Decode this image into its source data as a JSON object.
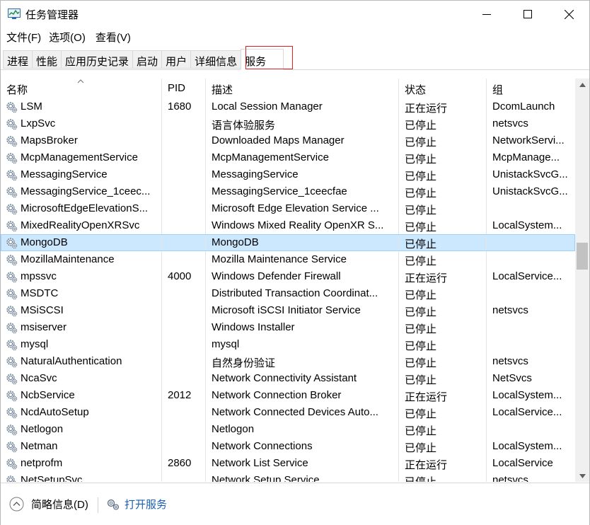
{
  "window": {
    "title": "任务管理器"
  },
  "menu": [
    {
      "label": "文件(F)"
    },
    {
      "label": "选项(O)"
    },
    {
      "label": "查看(V)"
    }
  ],
  "tabs": [
    {
      "label": "进程"
    },
    {
      "label": "性能"
    },
    {
      "label": "应用历史记录"
    },
    {
      "label": "启动"
    },
    {
      "label": "用户"
    },
    {
      "label": "详细信息"
    },
    {
      "label": "服务",
      "active": true
    }
  ],
  "columns": {
    "name": "名称",
    "pid": "PID",
    "desc": "描述",
    "status": "状态",
    "group": "组"
  },
  "rows": [
    {
      "name": "LSM",
      "pid": "1680",
      "desc": "Local Session Manager",
      "status": "正在运行",
      "group": "DcomLaunch"
    },
    {
      "name": "LxpSvc",
      "pid": "",
      "desc": "语言体验服务",
      "status": "已停止",
      "group": "netsvcs"
    },
    {
      "name": "MapsBroker",
      "pid": "",
      "desc": "Downloaded Maps Manager",
      "status": "已停止",
      "group": "NetworkServi..."
    },
    {
      "name": "McpManagementService",
      "pid": "",
      "desc": "McpManagementService",
      "status": "已停止",
      "group": "McpManage..."
    },
    {
      "name": "MessagingService",
      "pid": "",
      "desc": "MessagingService",
      "status": "已停止",
      "group": "UnistackSvcG..."
    },
    {
      "name": "MessagingService_1ceec...",
      "pid": "",
      "desc": "MessagingService_1ceecfae",
      "status": "已停止",
      "group": "UnistackSvcG..."
    },
    {
      "name": "MicrosoftEdgeElevationS...",
      "pid": "",
      "desc": "Microsoft Edge Elevation Service ...",
      "status": "已停止",
      "group": ""
    },
    {
      "name": "MixedRealityOpenXRSvc",
      "pid": "",
      "desc": "Windows Mixed Reality OpenXR S...",
      "status": "已停止",
      "group": "LocalSystem..."
    },
    {
      "name": "MongoDB",
      "pid": "",
      "desc": "MongoDB",
      "status": "已停止",
      "group": "",
      "selected": true
    },
    {
      "name": "MozillaMaintenance",
      "pid": "",
      "desc": "Mozilla Maintenance Service",
      "status": "已停止",
      "group": ""
    },
    {
      "name": "mpssvc",
      "pid": "4000",
      "desc": "Windows Defender Firewall",
      "status": "正在运行",
      "group": "LocalService..."
    },
    {
      "name": "MSDTC",
      "pid": "",
      "desc": "Distributed Transaction Coordinat...",
      "status": "已停止",
      "group": ""
    },
    {
      "name": "MSiSCSI",
      "pid": "",
      "desc": "Microsoft iSCSI Initiator Service",
      "status": "已停止",
      "group": "netsvcs"
    },
    {
      "name": "msiserver",
      "pid": "",
      "desc": "Windows Installer",
      "status": "已停止",
      "group": ""
    },
    {
      "name": "mysql",
      "pid": "",
      "desc": "mysql",
      "status": "已停止",
      "group": ""
    },
    {
      "name": "NaturalAuthentication",
      "pid": "",
      "desc": "自然身份验证",
      "status": "已停止",
      "group": "netsvcs"
    },
    {
      "name": "NcaSvc",
      "pid": "",
      "desc": "Network Connectivity Assistant",
      "status": "已停止",
      "group": "NetSvcs"
    },
    {
      "name": "NcbService",
      "pid": "2012",
      "desc": "Network Connection Broker",
      "status": "正在运行",
      "group": "LocalSystem..."
    },
    {
      "name": "NcdAutoSetup",
      "pid": "",
      "desc": "Network Connected Devices Auto...",
      "status": "已停止",
      "group": "LocalService..."
    },
    {
      "name": "Netlogon",
      "pid": "",
      "desc": "Netlogon",
      "status": "已停止",
      "group": ""
    },
    {
      "name": "Netman",
      "pid": "",
      "desc": "Network Connections",
      "status": "已停止",
      "group": "LocalSystem..."
    },
    {
      "name": "netprofm",
      "pid": "2860",
      "desc": "Network List Service",
      "status": "正在运行",
      "group": "LocalService"
    },
    {
      "name": "NetSetupSvc",
      "pid": "",
      "desc": "Network Setup Service",
      "status": "已停止",
      "group": "netsvcs"
    }
  ],
  "footer": {
    "fewer_details": "简略信息(D)",
    "open_services": "打开服务"
  },
  "icons": {
    "app": "task-manager-icon",
    "service": "gear-service-icon",
    "fewer": "chevron-up-circle-icon",
    "open": "services-gear-icon"
  },
  "colors": {
    "selected_row": "#cce8ff",
    "tab_highlight": "#e02020",
    "link": "#1a5fb4"
  }
}
